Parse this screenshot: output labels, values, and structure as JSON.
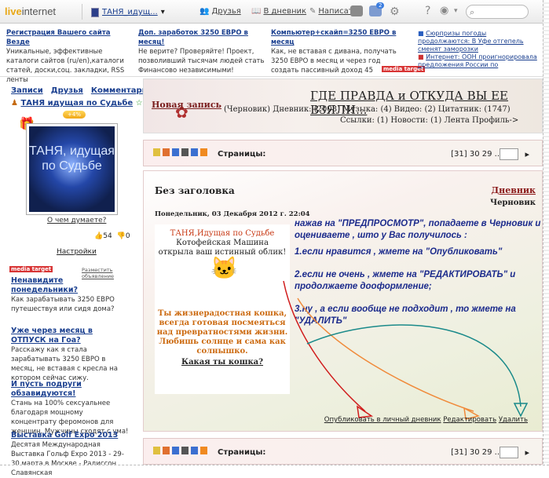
{
  "topbar": {
    "logo_prefix": "live",
    "logo_suffix": "internet",
    "user_name": "ТАНЯ_идущ...",
    "nav_friends": "Друзья",
    "nav_diary": "В дневник",
    "nav_write": "Написать",
    "notif_count": "2",
    "search_placeholder": ""
  },
  "ads": {
    "ad1_title": "Регистрация Вашего сайта Везде",
    "ad1_text": "Уникальные, эффективные каталоги сайтов (ru/en),каталоги статей, доски,соц. закладки, RSS ленты",
    "ad2_title": "Доп. заработок 3250 ЕВРО в месяц!",
    "ad2_text": "Не верите? Проверяйте! Проект, позволивший тысячам людей стать Финансово независимыми!",
    "ad3_title": "Компьютер+скайп=3250 ЕВРО в месяц",
    "ad3_text": "Как, не вставая с дивана, получать 3250 ЕВРО в месяц и через год создать пассивный доход 45",
    "media_target": "media target",
    "news1": "Сюрпризы погоды продолжаются: В Уфе отгепель сменят заморозки",
    "news2": "Интернет: ООН проигнорировала предложения России по"
  },
  "left": {
    "tab_records": "Записи",
    "tab_friends": "Друзья",
    "tab_comments": "Комментарии",
    "user_name": "ТАНЯ идущая по Судьбе",
    "rating_badge": "+4%",
    "avatar_text": "ТАНЯ, идущая по Судьбе",
    "mood_link": "О чем думаете?",
    "likes": "54",
    "views": "0",
    "settings": "Настройки",
    "media_target": "media target",
    "place_ad": "Разместить объявление",
    "items": [
      {
        "title": "Ненавидите понедельники?",
        "text": "Как зарабатывать 3250 ЕВРО путешествуя или сидя дома?"
      },
      {
        "title": "Уже через месяц в ОТПУСК на Гоа?",
        "text": "Расскажу как я стала зарабатывать 3250 ЕВРО в месяц, не вставая с кресла на котором сейчас сижу."
      },
      {
        "title": "И пусть подруги обзавидуются!",
        "text": "Стань на 100% сексуальнее благодаря мощному концентрату феромонов для женщин. Мужчины сходят с ума!"
      },
      {
        "title": "Выставка Golf Expo 2013",
        "text": "Десятая Международная Выставка Гольф Expo 2013 - 29-30 марта в Москве - Радиссон Славянская"
      }
    ]
  },
  "header": {
    "new_record": "Новая запись",
    "diary_title": "ГДЕ ПРАВДА и ОТКУДА ВЫ ЕЕ ВЗЯЛИ...",
    "links_line1": "(Черновик)  Дневник: (2003)  Музыка: (4)  Видео: (2)  Цитатник: (1747)",
    "links_line2": "Ссылки: (1)  Новости: (1)  Лента  Профиль->"
  },
  "pager": {
    "label": "Страницы:",
    "pages": "[31] 30 29 ..",
    "next": "▸"
  },
  "post": {
    "title": "Без заголовка",
    "diary_link": "Дневник",
    "draft_label": "Черновик",
    "date": "Понедельник, 03 Декабря 2012 г. 22:04",
    "card_name": "ТАНЯ,Идущая по Судьбе",
    "card_line1": "Котофейская Машина",
    "card_line2": "открыла ваш истинный облик!",
    "card_result": "Ты жизнерадостная кошка, всегда готовая посмеяться над превратностями жизни. Любишь солнце и сама как солнышко.",
    "card_link": "Какая ты кошка?",
    "instr1": "нажав на \"ПРЕДПРОСМОТР\", попадаете в Черновик и оцениваете , што у Вас получилось :",
    "instr2": "1.если нравится , жмете на \"Опубликовать\"",
    "instr3": "2.если не очень , жмете на \"РЕДАКТИРОВАТЬ\" и продолжаете дооформление;",
    "instr4": "3.ну , а если вообще не подходит , то жмете на \"УДАЛИТЬ\"",
    "act_publish": "Опубликовать в личный дневник",
    "act_edit": "Редактировать",
    "act_delete": "Удалить"
  },
  "colors": {
    "arrow_red": "#d01c1c",
    "arrow_orange": "#f08a3a",
    "arrow_teal": "#1a8a8a",
    "instr_blue": "#1c2b8c"
  }
}
